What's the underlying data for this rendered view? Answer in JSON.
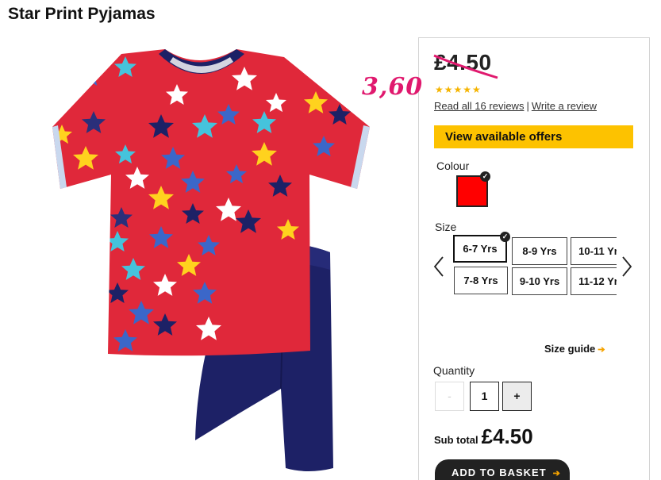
{
  "product": {
    "title": "Star Print Pyjamas",
    "image_alt": "Red star print t-shirt with navy shorts"
  },
  "price": {
    "original": "£4.50",
    "handwritten_note": "3,60",
    "rating_stars": "★★★★★",
    "rating": 5,
    "reviews_link": "Read all 16 reviews",
    "separator": "|",
    "write_review_link": "Write a review"
  },
  "offers": {
    "label": "View available offers"
  },
  "colour": {
    "label": "Colour",
    "selected": "red",
    "swatch_color": "#ff0000"
  },
  "size": {
    "label": "Size",
    "options": [
      "6-7 Yrs",
      "8-9 Yrs",
      "10-11 Yr",
      "7-8 Yrs",
      "9-10 Yrs",
      "11-12 Yr"
    ],
    "selected": "6-7 Yrs",
    "guide_label": "Size guide"
  },
  "quantity": {
    "label": "Quantity",
    "minus": "-",
    "value": "1",
    "plus": "+"
  },
  "subtotal": {
    "label": "Sub total",
    "value": "£4.50"
  },
  "basket": {
    "label": "ADD TO BASKET"
  },
  "colors": {
    "offer_button": "#fdc200",
    "basket_button": "#222222",
    "arrow_accent": "#f5a300",
    "handwriting": "#e0196e",
    "star": "#f5b400"
  },
  "icons": {
    "check": "check-icon",
    "arrow_left": "chevron-left-icon",
    "arrow_right": "chevron-right-icon",
    "arrow_small": "arrow-right-icon"
  }
}
